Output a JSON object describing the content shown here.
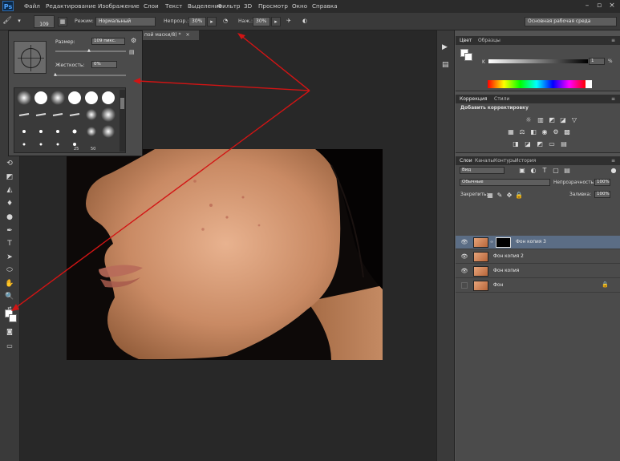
{
  "menubar": {
    "logo": "Ps",
    "items": [
      "Файл",
      "Редактирование",
      "Изображение",
      "Слои",
      "Текст",
      "Выделение",
      "Фильтр",
      "3D",
      "Просмотр",
      "Окно",
      "Справка"
    ]
  },
  "options_bar": {
    "brush_size": "109",
    "mode_label": "Режим:",
    "mode_value": "Нормальный",
    "opacity_label": "Непрозр.:",
    "opacity_value": "30%",
    "flow_label": "Наж.:",
    "flow_value": "30%",
    "workspace_value": "Основная рабочая среда"
  },
  "document_tab": {
    "title": "пой маски/8) *",
    "close": "×"
  },
  "brush_popup": {
    "size_label": "Размер:",
    "size_value": "109 пикс.",
    "hardness_label": "Жесткость:",
    "hardness_value": "0%",
    "brush_numbers": [
      "25",
      "50"
    ]
  },
  "color_panel": {
    "tabs": [
      "Цвет",
      "Образцы"
    ],
    "channel_label": "K",
    "channel_value": "1",
    "percent": "%"
  },
  "adjustments_panel": {
    "tabs": [
      "Коррекция",
      "Стили"
    ],
    "heading": "Добавить корректировку"
  },
  "layers_panel": {
    "tabs": [
      "Слои",
      "Каналы",
      "Контуры",
      "История"
    ],
    "filter_value": "Вид",
    "blend_value": "Обычные",
    "opacity_label": "Непрозрачность:",
    "opacity_value": "100%",
    "lock_label": "Закрепить:",
    "fill_label": "Заливка:",
    "fill_value": "100%",
    "layers": [
      {
        "name": "Фон копия 3",
        "visible": true,
        "selected": true,
        "has_mask": true
      },
      {
        "name": "Фон копия 2",
        "visible": true,
        "selected": false,
        "has_mask": false
      },
      {
        "name": "Фон копия",
        "visible": true,
        "selected": false,
        "has_mask": false
      },
      {
        "name": "Фон",
        "visible": false,
        "selected": false,
        "has_mask": false,
        "locked": true
      }
    ]
  },
  "colors": {
    "annotation_arrow": "#d21414",
    "selected_layer": "#5b6d85",
    "panel_bg": "#4b4b4b"
  }
}
